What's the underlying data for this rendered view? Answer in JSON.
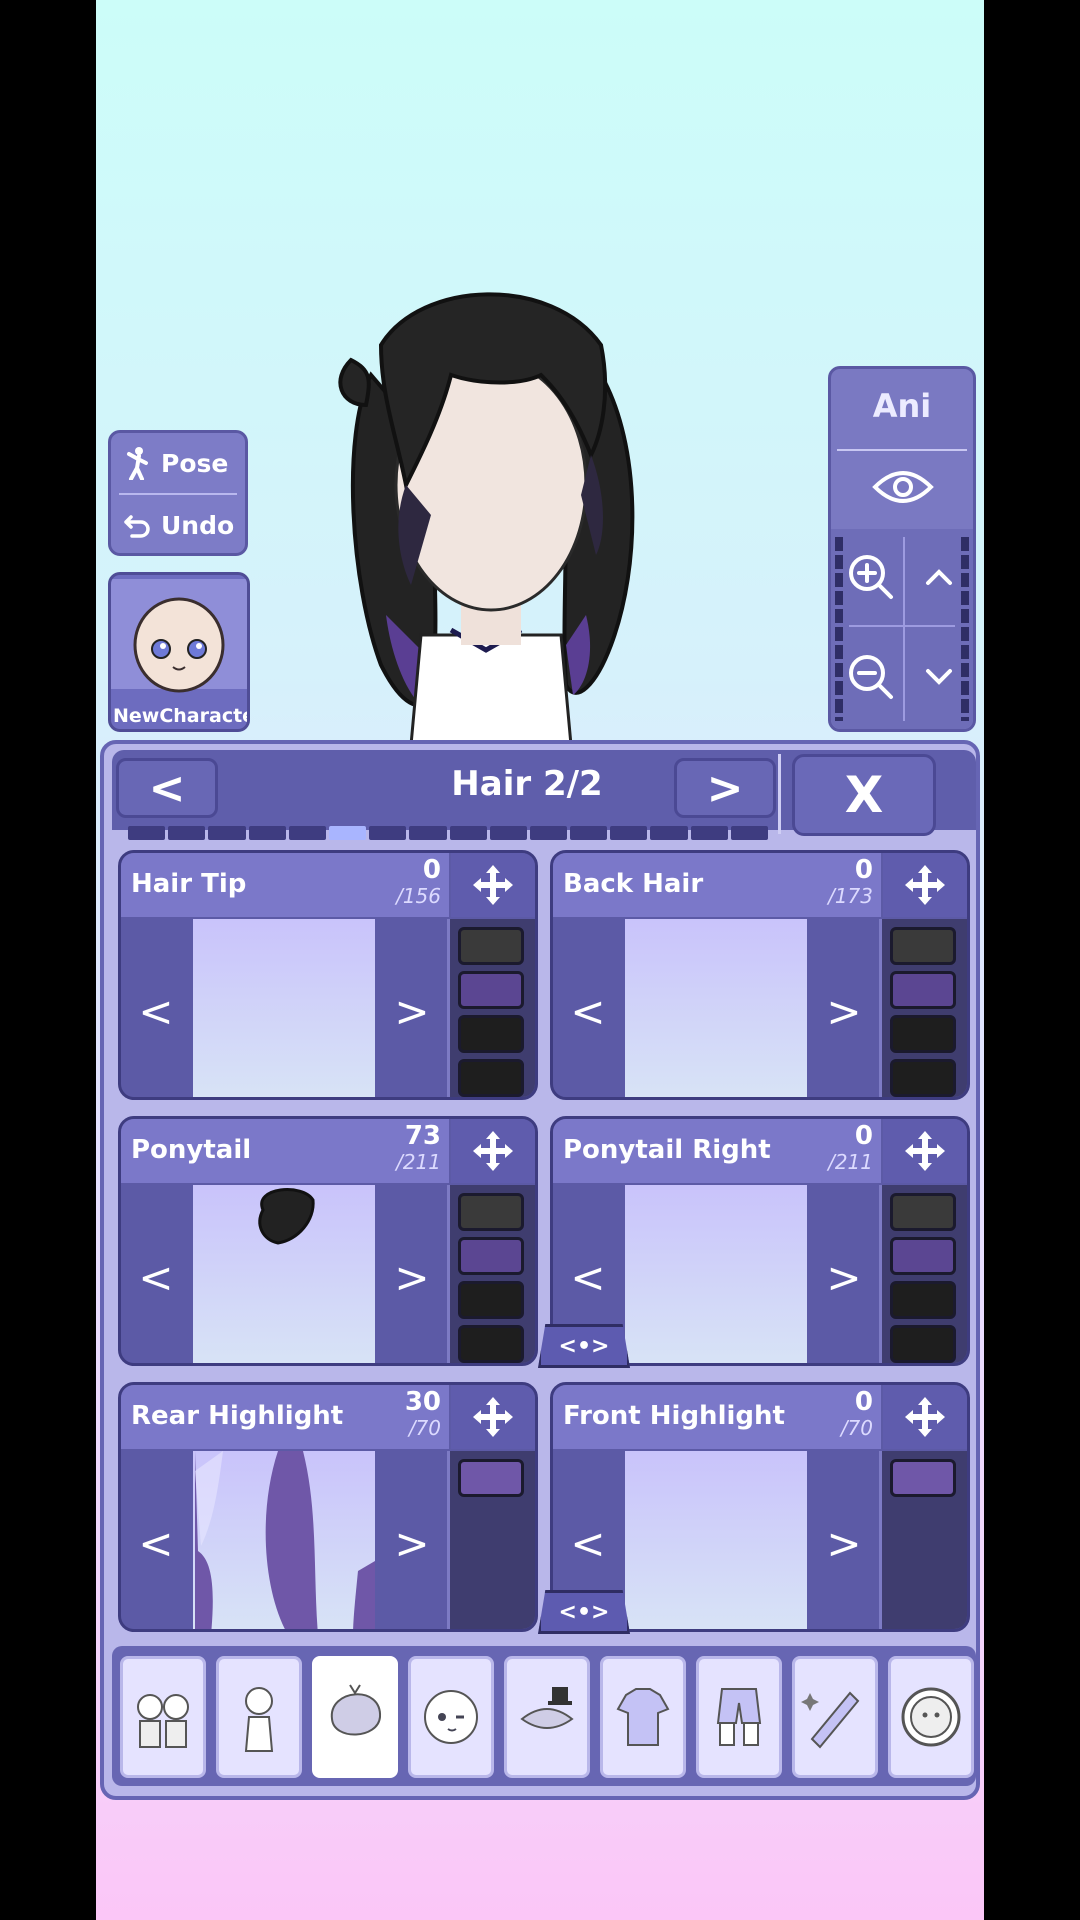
{
  "toolbar": {
    "pose_label": "Pose",
    "undo_label": "Undo"
  },
  "character_slot": {
    "name": "NewCharacter"
  },
  "camera": {
    "ani_label": "Ani",
    "zoom_level": 0.5
  },
  "editor": {
    "title": "Hair 2/2",
    "prev_label": "<",
    "next_label": ">",
    "close_label": "X",
    "progress_segments": 16,
    "progress_active": 5
  },
  "cards": [
    {
      "title": "Hair Tip",
      "value": "0",
      "total": "/156",
      "swatch_count": 4
    },
    {
      "title": "Back Hair",
      "value": "0",
      "total": "/173",
      "swatch_count": 4
    },
    {
      "title": "Ponytail",
      "value": "73",
      "total": "/211",
      "swatch_count": 4
    },
    {
      "title": "Ponytail Right",
      "value": "0",
      "total": "/211",
      "swatch_count": 4
    },
    {
      "title": "Rear Highlight",
      "value": "30",
      "total": "/70",
      "swatch_count": 1
    },
    {
      "title": "Front Highlight",
      "value": "0",
      "total": "/70",
      "swatch_count": 1
    }
  ],
  "swatch_colors": [
    "#3a3a3a",
    "#5b4692",
    "#1e1e1e",
    "#1e1e1e"
  ],
  "highlight_color": "#6f57a8",
  "arrow_left": "<",
  "arrow_right": ">",
  "mirror_tab_label": "<•>",
  "categories": [
    {
      "icon": "presets-icon",
      "active": false
    },
    {
      "icon": "body-icon",
      "active": false
    },
    {
      "icon": "hair-icon",
      "active": true
    },
    {
      "icon": "face-icon",
      "active": false
    },
    {
      "icon": "accessories-icon",
      "active": false
    },
    {
      "icon": "top-clothing-icon",
      "active": false
    },
    {
      "icon": "bottom-clothing-icon",
      "active": false
    },
    {
      "icon": "props-icon",
      "active": false
    },
    {
      "icon": "profile-icon",
      "active": false
    }
  ],
  "colors": {
    "panel": "#5f5eab",
    "accent": "#a9b5ff",
    "card": "#5c5aa6"
  }
}
